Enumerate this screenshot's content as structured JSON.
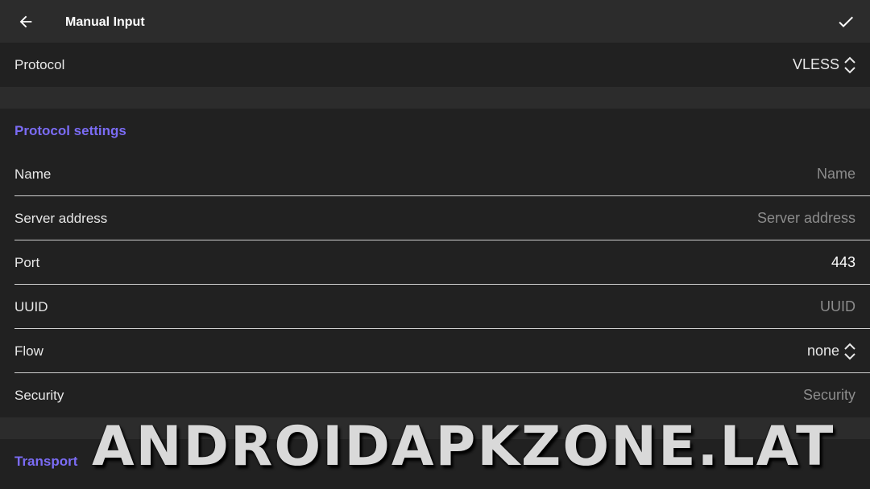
{
  "appbar": {
    "title": "Manual Input",
    "back_icon": "arrow-left-icon",
    "confirm_icon": "check-icon"
  },
  "protocol": {
    "label": "Protocol",
    "value": "VLESS"
  },
  "protocol_settings": {
    "title": "Protocol settings",
    "fields": {
      "name": {
        "label": "Name",
        "placeholder": "Name"
      },
      "server": {
        "label": "Server address",
        "placeholder": "Server address"
      },
      "port": {
        "label": "Port",
        "value": "443"
      },
      "uuid": {
        "label": "UUID",
        "placeholder": "UUID"
      },
      "flow": {
        "label": "Flow",
        "value": "none"
      },
      "security": {
        "label": "Security",
        "placeholder": "Security"
      }
    }
  },
  "transport": {
    "title": "Transport"
  },
  "watermark": "ANDROIDAPKZONE.LAT",
  "colors": {
    "accent": "#7b6cf5",
    "surface": "#212121",
    "appbar": "#2c2c2c"
  }
}
